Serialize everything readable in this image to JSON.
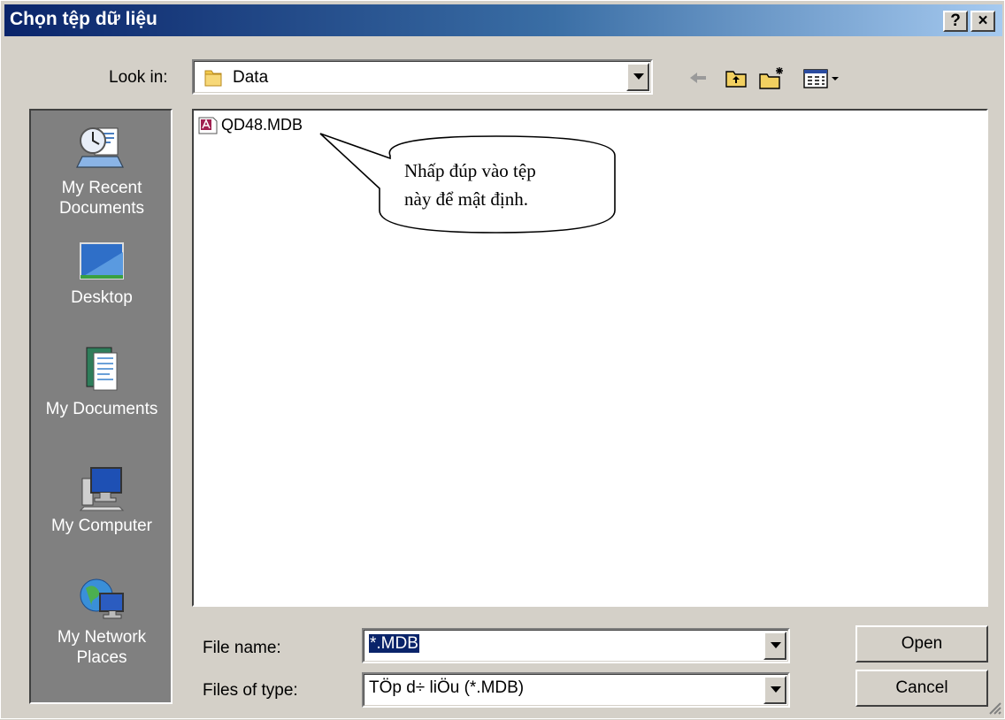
{
  "window": {
    "title": "Chọn tệp dữ liệu",
    "help_label": "?",
    "close_label": "×"
  },
  "lookin": {
    "label": "Look in:",
    "value": "Data"
  },
  "toolbar": {
    "icons": [
      "back-arrow-icon",
      "up-folder-icon",
      "new-folder-icon",
      "view-menu-icon"
    ]
  },
  "places": [
    {
      "label": "My Recent Documents",
      "icon": "recent-documents-icon"
    },
    {
      "label": "Desktop",
      "icon": "desktop-icon"
    },
    {
      "label": "My Documents",
      "icon": "my-documents-icon"
    },
    {
      "label": "My Computer",
      "icon": "computer-icon"
    },
    {
      "label": "My Network Places",
      "icon": "network-icon"
    }
  ],
  "files": [
    {
      "name": "QD48.MDB",
      "icon": "access-db-icon"
    }
  ],
  "callout": {
    "line1": "Nhấp đúp vào tệp",
    "line2": "này để mật định."
  },
  "filename": {
    "label": "File name:",
    "value": "*.MDB"
  },
  "filetype": {
    "label": "Files of type:",
    "value": "TÖp d÷ liÖu (*.MDB)"
  },
  "buttons": {
    "open": "Open",
    "cancel": "Cancel"
  },
  "colors": {
    "title_start": "#0a246a",
    "title_end": "#a6caf0",
    "face": "#d4d0c8",
    "places_bg": "#808080"
  }
}
